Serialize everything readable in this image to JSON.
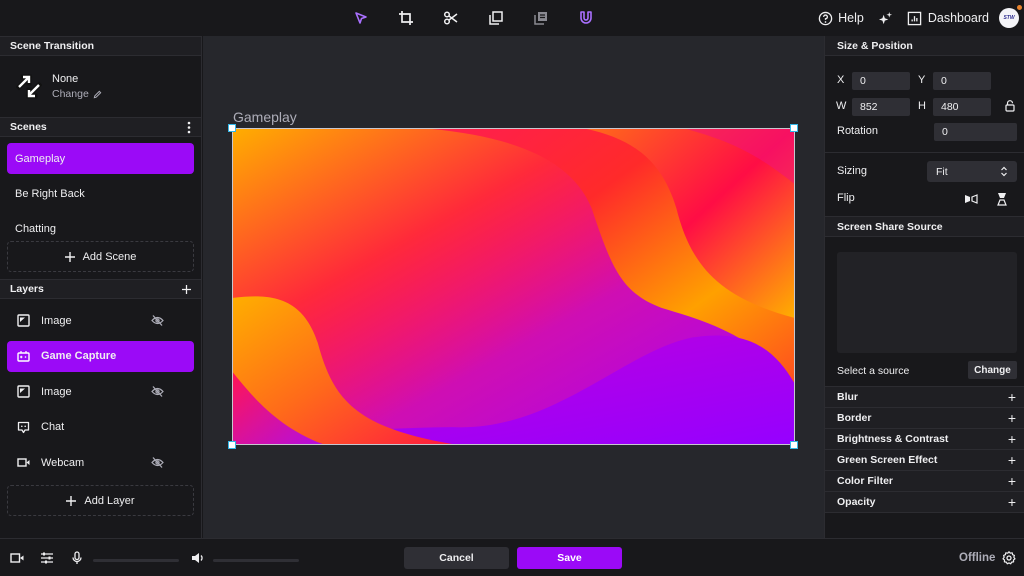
{
  "toolbar": {
    "tools": [
      {
        "name": "select-tool",
        "icon": "cursor-arrow-icon",
        "active": true
      },
      {
        "name": "crop-tool",
        "icon": "crop-icon",
        "active": false
      },
      {
        "name": "cut-tool",
        "icon": "scissors-icon",
        "active": false
      },
      {
        "name": "duplicate-tool",
        "icon": "copy-icon",
        "active": false
      },
      {
        "name": "layers-tool",
        "icon": "stack-icon",
        "active": false
      },
      {
        "name": "snap-tool",
        "icon": "magnet-icon",
        "active": true
      }
    ],
    "help_label": "Help",
    "dashboard_label": "Dashboard",
    "avatar_text": "STW",
    "accent_color": "#9b0af7"
  },
  "scene_transition": {
    "title": "Scene Transition",
    "current": "None",
    "change_label": "Change"
  },
  "scenes": {
    "title": "Scenes",
    "items": [
      {
        "label": "Gameplay",
        "active": true
      },
      {
        "label": "Be Right Back",
        "active": false
      },
      {
        "label": "Chatting",
        "active": false
      }
    ],
    "add_label": "Add Scene"
  },
  "layers": {
    "title": "Layers",
    "items": [
      {
        "label": "Image",
        "icon": "image-icon",
        "hidden": true,
        "active": false
      },
      {
        "label": "Game Capture",
        "icon": "gamepad-icon",
        "hidden": false,
        "active": true
      },
      {
        "label": "Image",
        "icon": "image-icon",
        "hidden": true,
        "active": false
      },
      {
        "label": "Chat",
        "icon": "chat-icon",
        "hidden": false,
        "active": false
      },
      {
        "label": "Webcam",
        "icon": "camera-icon",
        "hidden": true,
        "active": false
      }
    ],
    "add_label": "Add Layer"
  },
  "canvas": {
    "scene_label": "Gameplay"
  },
  "size_position": {
    "title": "Size & Position",
    "x_label": "X",
    "x_value": "0",
    "y_label": "Y",
    "y_value": "0",
    "w_label": "W",
    "w_value": "852",
    "h_label": "H",
    "h_value": "480",
    "rotation_label": "Rotation",
    "rotation_value": "0",
    "sizing_label": "Sizing",
    "sizing_value": "Fit",
    "flip_label": "Flip"
  },
  "screen_share": {
    "title": "Screen Share Source",
    "select_text": "Select a source",
    "change_label": "Change"
  },
  "effects": [
    {
      "label": "Blur"
    },
    {
      "label": "Border"
    },
    {
      "label": "Brightness & Contrast"
    },
    {
      "label": "Green Screen Effect"
    },
    {
      "label": "Color Filter"
    },
    {
      "label": "Opacity"
    }
  ],
  "bottom": {
    "cancel_label": "Cancel",
    "save_label": "Save",
    "status": "Offline"
  }
}
